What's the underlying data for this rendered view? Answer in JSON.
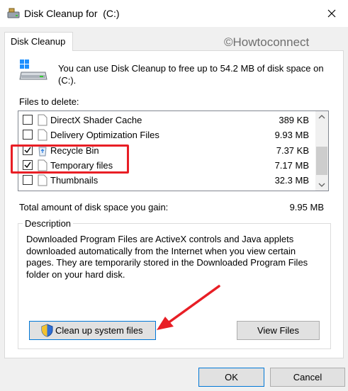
{
  "window": {
    "title": "Disk Cleanup for  (C:)",
    "close_glyph": "✕"
  },
  "tabs": [
    {
      "label": "Disk Cleanup"
    }
  ],
  "watermark": "©Howtoconnect",
  "intro": "You can use Disk Cleanup to free up to 54.2 MB of disk space on (C:).",
  "files_label": "Files to delete:",
  "files": [
    {
      "label": "DirectX Shader Cache",
      "size": "389 KB",
      "checked": false,
      "icon": "file-icon"
    },
    {
      "label": "Delivery Optimization Files",
      "size": "9.93 MB",
      "checked": false,
      "icon": "file-icon"
    },
    {
      "label": "Recycle Bin",
      "size": "7.37 KB",
      "checked": true,
      "icon": "recycle-bin-icon"
    },
    {
      "label": "Temporary files",
      "size": "7.17 MB",
      "checked": true,
      "icon": "file-icon"
    },
    {
      "label": "Thumbnails",
      "size": "32.3 MB",
      "checked": false,
      "icon": "file-icon"
    }
  ],
  "total": {
    "label": "Total amount of disk space you gain:",
    "value": "9.95 MB"
  },
  "description": {
    "legend": "Description",
    "text": "Downloaded Program Files are ActiveX controls and Java applets downloaded automatically from the Internet when you view certain pages. They are temporarily stored in the Downloaded Program Files folder on your hard disk."
  },
  "buttons": {
    "cleanup_system": "Clean up system files",
    "view_files": "View Files",
    "ok": "OK",
    "cancel": "Cancel"
  },
  "colors": {
    "accent": "#0078d7",
    "annotation": "#e81e25"
  }
}
